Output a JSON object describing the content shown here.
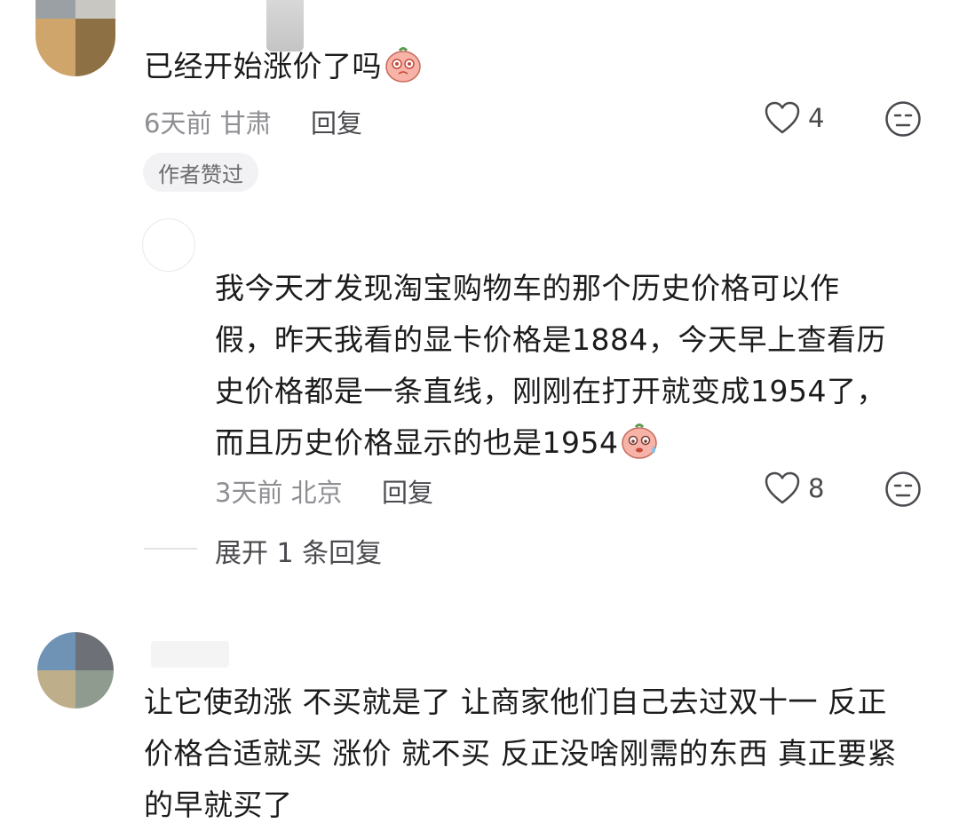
{
  "comments": [
    {
      "text": "已经开始涨价了吗",
      "emoji": "pleading-face-sticker",
      "time": "6天前",
      "location": "甘肃",
      "reply_label": "回复",
      "likes": "4",
      "badge": "作者赞过"
    },
    {
      "lines": [
        "我今天才发现淘宝购物车的那个历史价格可以作",
        "假，昨天我看的显卡价格是1884，今天早上查看历",
        "史价格都是一条直线，刚刚在打开就变成1954了，",
        "而且历史价格显示的也是1954"
      ],
      "emoji": "sweating-face-sticker",
      "time": "3天前",
      "location": "北京",
      "reply_label": "回复",
      "likes": "8",
      "expand_label": "展开 1 条回复"
    },
    {
      "lines": [
        "让它使劲涨 不买就是了 让商家他们自己去过双十一 反正",
        "价格合适就买 涨价 就不买 反正没啥刚需的东西 真正要紧",
        "的早就买了"
      ]
    }
  ],
  "icons": {
    "like": "heart-outline-icon",
    "dislike": "unhappy-face-icon"
  },
  "colors": {
    "text": "#1c1c1e",
    "meta": "#8e8e93",
    "badge_bg": "#f2f2f4",
    "sticker_pink": "#f7b3a8"
  }
}
